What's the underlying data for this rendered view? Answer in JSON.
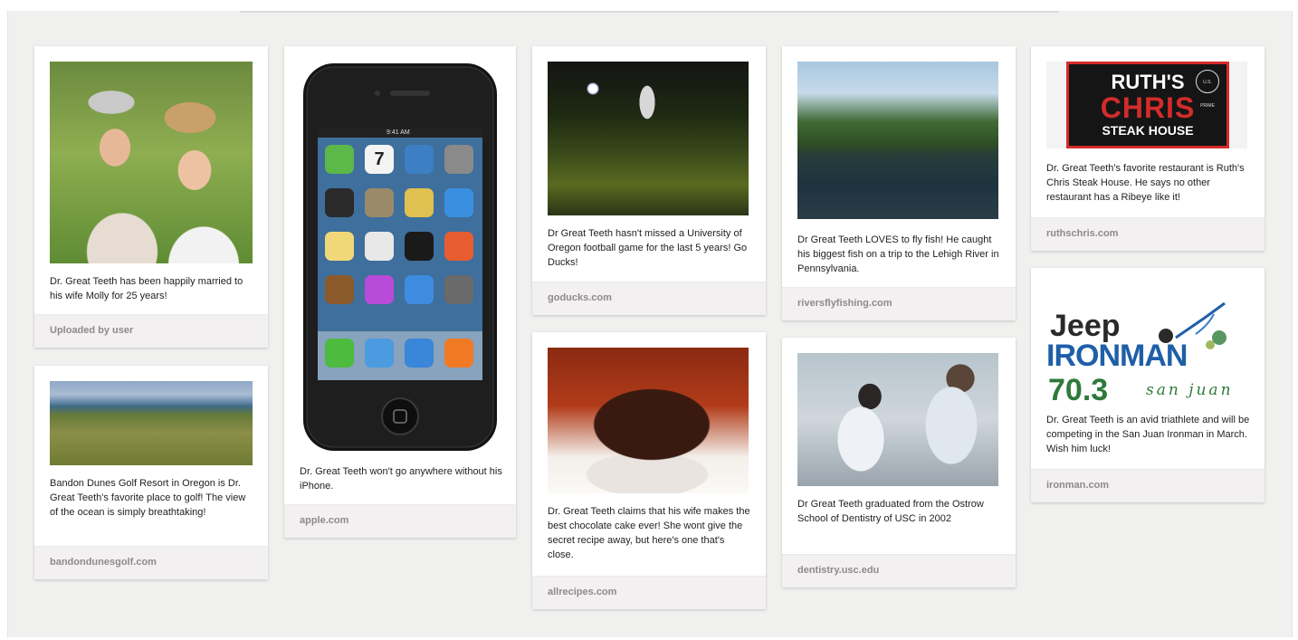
{
  "board": {
    "pins": [
      {
        "id": "couple",
        "image_alt": "couple photo",
        "description": "Dr. Great Teeth has been happily married to his wife Molly for 25 years!",
        "source": "Uploaded by user"
      },
      {
        "id": "golf",
        "image_alt": "golf course by the ocean",
        "description": "Bandon Dunes Golf Resort in Oregon is Dr. Great Teeth's favorite place to golf! The view of the ocean is simply breathtaking!",
        "source": "bandondunesgolf.com"
      },
      {
        "id": "iphone",
        "image_alt": "iPhone",
        "description": "Dr. Great Teeth won't go anywhere without his iPhone.",
        "source": "apple.com",
        "phone": {
          "status_time": "9:41 AM",
          "calendar_day": "7"
        }
      },
      {
        "id": "ducks",
        "image_alt": "football fans with trophy",
        "description": "Dr Great Teeth hasn't missed a University of Oregon football game for the last 5 years! Go Ducks!",
        "source": "goducks.com"
      },
      {
        "id": "cake",
        "image_alt": "chocolate cake",
        "description": "Dr. Great Teeth claims that his wife makes the best chocolate cake ever! She wont give the secret recipe away, but here's one that's close.",
        "source": "allrecipes.com"
      },
      {
        "id": "river",
        "image_alt": "river",
        "description": "Dr Great Teeth LOVES to fly fish! He caught his biggest fish on a trip to the Lehigh River in Pennsylvania.",
        "source": "riversflyfishing.com"
      },
      {
        "id": "dental",
        "image_alt": "dentists at work",
        "description": "Dr Great Teeth graduated from the Ostrow School of Dentistry of USC in 2002",
        "source": "dentistry.usc.edu"
      },
      {
        "id": "ruth",
        "image_alt": "Ruth's Chris Steak House logo",
        "description": "Dr. Great Teeth's favorite restaurant is Ruth's Chris Steak House. He says no other restaurant has a Ribeye like it!",
        "source": "ruthschris.com",
        "logo": {
          "line1": "RUTH'S",
          "line2": "CHRIS",
          "line3": "STEAK HOUSE",
          "seal": "U.S. PRIME"
        }
      },
      {
        "id": "ironman",
        "image_alt": "Jeep Ironman 70.3 San Juan logo",
        "description": "Dr. Great Teeth is an avid triathlete and will be competing in the San Juan Ironman in March. Wish him luck!",
        "source": "ironman.com",
        "logo": {
          "brand": "Jeep",
          "event": "IRONMAN",
          "distance": "70.3",
          "location": "san juan"
        }
      }
    ]
  },
  "colors": {
    "board_bg": "#f0f0ef",
    "source_bar": "#f2f0f0",
    "source_text": "#8d8a8a",
    "ruth_red": "#d42b2b",
    "iron_blue": "#1f5fa8",
    "iron_green": "#2f7a3a"
  }
}
